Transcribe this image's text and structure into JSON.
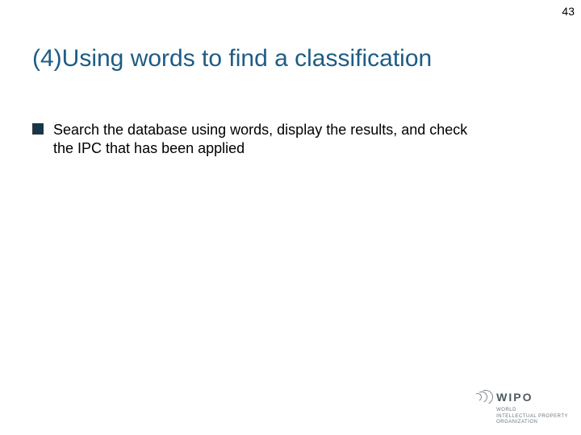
{
  "page_number": "43",
  "title": "(4)Using words to find a classification",
  "bullets": [
    "Search the database using words, display the results, and check the IPC that has been applied"
  ],
  "footer": {
    "org_name": "WIPO",
    "sub1": "WORLD",
    "sub2": "INTELLECTUAL PROPERTY",
    "sub3": "ORGANIZATION"
  }
}
